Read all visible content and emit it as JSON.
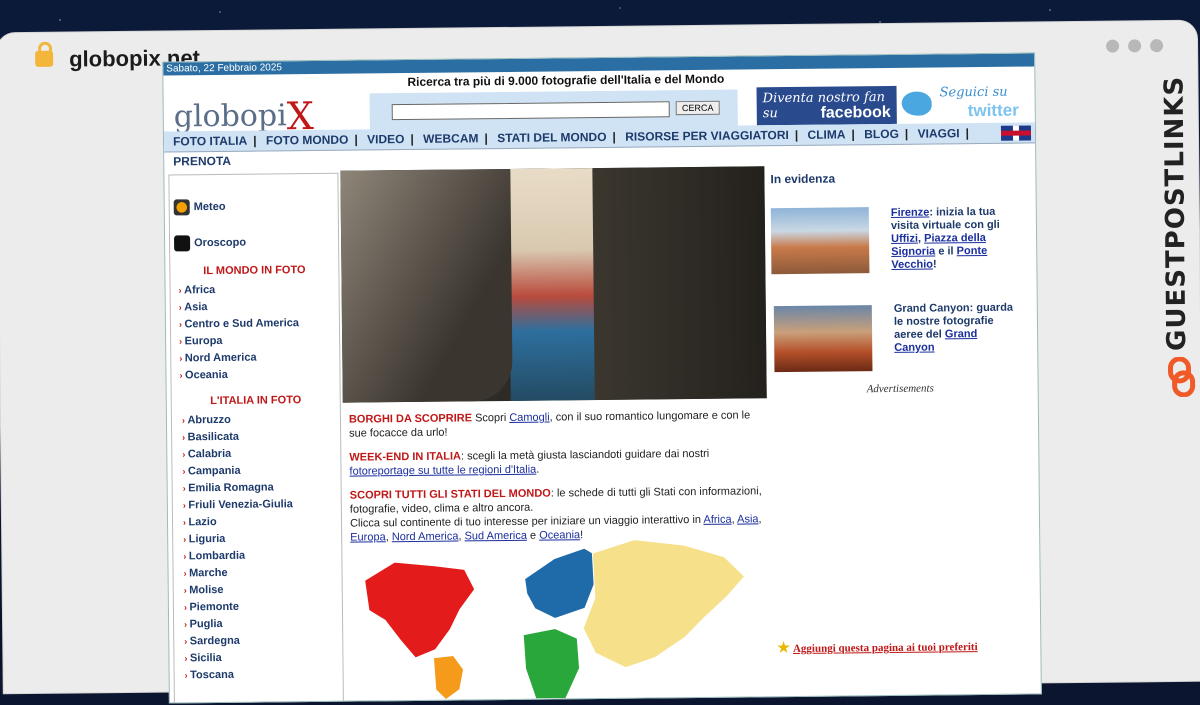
{
  "browser": {
    "url": "globopix.net"
  },
  "watermark": {
    "text": "GUESTPOSTLINKS"
  },
  "site": {
    "date": "Sabato, 22 Febbraio 2025",
    "logo_main": "globopi",
    "logo_x": "X",
    "search_title": "Ricerca tra più di 9.000 fotografie dell'Italia e del Mondo",
    "search_button": "CERCA",
    "facebook_line1": "Diventa nostro fan su",
    "facebook_line2": "facebook",
    "twitter_line1": "Seguici su",
    "twitter_line2": "twitter",
    "nav": [
      "FOTO ITALIA",
      "FOTO MONDO",
      "VIDEO",
      "WEBCAM",
      "STATI DEL MONDO",
      "RISORSE PER VIAGGIATORI",
      "CLIMA",
      "BLOG",
      "VIAGGI",
      "PRENOTA"
    ],
    "sidebar": {
      "meteo": "Meteo",
      "oroscopo": "Oroscopo",
      "world_title": "IL MONDO IN FOTO",
      "world": [
        "Africa",
        "Asia",
        "Centro e Sud America",
        "Europa",
        "Nord America",
        "Oceania"
      ],
      "italy_title": "L'ITALIA IN FOTO",
      "italy": [
        "Abruzzo",
        "Basilicata",
        "Calabria",
        "Campania",
        "Emilia Romagna",
        "Friuli Venezia-Giulia",
        "Lazio",
        "Liguria",
        "Lombardia",
        "Marche",
        "Molise",
        "Piemonte",
        "Puglia",
        "Sardegna",
        "Sicilia",
        "Toscana"
      ]
    },
    "content": {
      "p1_red": "BORGHI DA SCOPRIRE",
      "p1_a": " Scopri ",
      "p1_link": "Camogli",
      "p1_b": ", con il suo romantico lungomare e con le sue focacce da urlo!",
      "p2_red": "WEEK-END IN ITALIA",
      "p2_a": ": scegli la metà giusta lasciandoti guidare dai nostri ",
      "p2_link": "fotoreportage su tutte le regioni d'Italia",
      "p2_b": ".",
      "p3_red": "SCOPRI TUTTI GLI STATI DEL MONDO",
      "p3_a": ": le schede di tutti gli Stati con informazioni, fotografie, video, clima e altro ancora.",
      "p3_b": "Clicca sul continente di tuo interesse per iniziare un viaggio interattivo in ",
      "p3_l1": "Africa",
      "p3_l2": "Asia",
      "p3_l3": "Europa",
      "p3_l4": "Nord America",
      "p3_l5": "Sud America",
      "p3_l6": "Oceania",
      "p3_comma": ", ",
      "p3_e": " e ",
      "p3_end": "!"
    },
    "evidence": {
      "title": "In evidenza",
      "item1_link1": "Firenze",
      "item1_text1": ": inizia la tua visita virtuale con gli ",
      "item1_link2": "Uffizi",
      "item1_comma": ", ",
      "item1_link3": "Piazza della Signoria",
      "item1_text2": " e il ",
      "item1_link4": "Ponte Vecchio",
      "item1_end": "!",
      "item2_text": "Grand Canyon: guarda le nostre fotografie aeree del ",
      "item2_link": "Grand Canyon"
    },
    "ads_label": "Advertisements",
    "favorites": "Aggiungi questa pagina ai tuoi preferiti"
  }
}
